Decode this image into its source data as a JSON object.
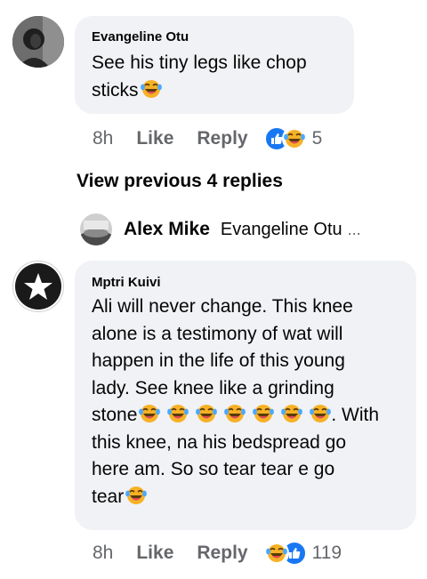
{
  "comment1": {
    "author": "Evangeline Otu",
    "text_line1": "See his tiny legs like chop",
    "text_line2": "sticks",
    "time": "8h",
    "like": "Like",
    "reply": "Reply",
    "reaction_count": "5"
  },
  "view_previous": "View previous 4 replies",
  "reply_preview": {
    "author": "Alex Mike",
    "snippet": "Evangeline Otu",
    "ellipsis": "..."
  },
  "comment2": {
    "author": "Mptri Kuivi",
    "lines": [
      "Ali will never change. This knee",
      "alone is a testimony of wat will",
      "happen in the life of this young",
      "lady. See knee like a grinding"
    ],
    "line5_start": "stone",
    "line5_end": ". With",
    "line6": "this knee, na his bedspread go",
    "line7": "here am. So so tear tear e go",
    "line8": "tear",
    "time": "8h",
    "like": "Like",
    "reply": "Reply",
    "reaction_count": "119"
  },
  "icons": [
    "laughing-tears-emoji",
    "like-reaction-icon",
    "haha-reaction-icon",
    "star-avatar-icon"
  ],
  "colors": {
    "bubble": "#f0f2f5",
    "meta_text": "#65676b",
    "like_blue": "#1877f2",
    "haha_yellow": "#f7b125"
  }
}
